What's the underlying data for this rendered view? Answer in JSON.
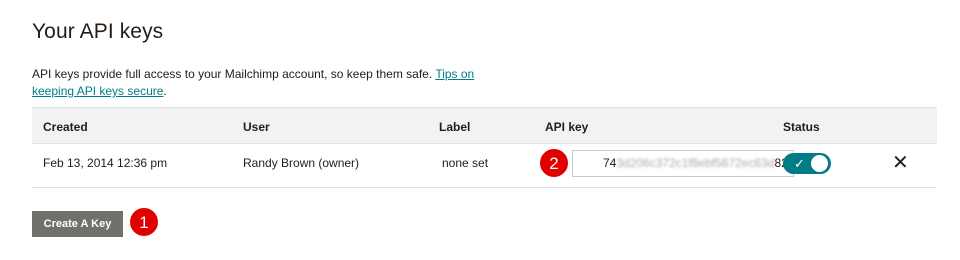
{
  "page": {
    "title": "Your API keys",
    "description_prefix": "API keys provide full access to your Mailchimp account, so keep them safe. ",
    "description_link": "Tips on keeping API keys secure",
    "description_suffix": "."
  },
  "table": {
    "headers": {
      "created": "Created",
      "user": "User",
      "label": "Label",
      "api_key": "API key",
      "status": "Status"
    },
    "rows": [
      {
        "created": "Feb 13, 2014 12:36 pm",
        "user": "Randy Brown (owner)",
        "label": "none set",
        "api_key_prefix": "74",
        "api_key_hidden": "3d206c372c1f8ebf5672ec63d",
        "api_key_suffix": "82",
        "status_enabled": true,
        "status_check_icon": "check-icon",
        "delete_icon": "close-icon"
      }
    ]
  },
  "actions": {
    "create_key_label": "Create A Key"
  },
  "annotations": {
    "badge_1": "1",
    "badge_2": "2"
  },
  "colors": {
    "link": "#007c89",
    "toggle_on": "#007c89",
    "button_bg": "#72706b",
    "badge": "#e10000"
  }
}
